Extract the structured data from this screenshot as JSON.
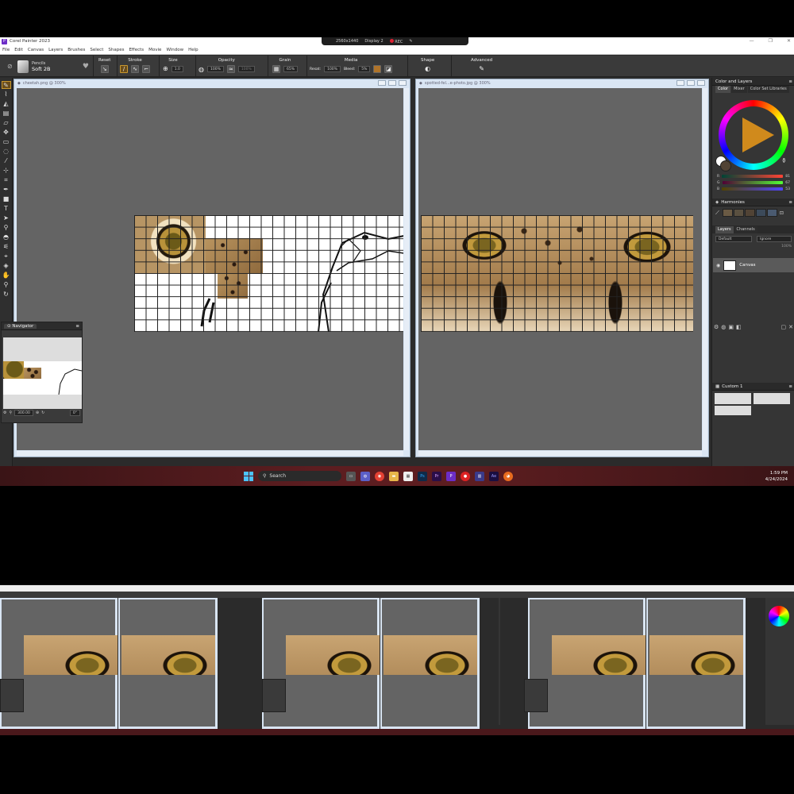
{
  "recording_bar": {
    "resolution": "2560x1440",
    "display": "Display 2",
    "rec_label": "REC"
  },
  "app": {
    "title": "Corel Painter 2023",
    "icon_letter": "P",
    "window_buttons": [
      "—",
      "❐",
      "✕"
    ]
  },
  "menu": [
    "File",
    "Edit",
    "Canvas",
    "Layers",
    "Brushes",
    "Select",
    "Shapes",
    "Effects",
    "Movie",
    "Window",
    "Help"
  ],
  "property_bar": {
    "brush_category": "Pencils",
    "brush_variant": "Soft 2B",
    "groups": {
      "reset": "Reset",
      "stroke": "Stroke",
      "size": "Size",
      "size_value": "1.0",
      "opacity": "Opacity",
      "opacity_value": "100%",
      "opacity_value2": "100%",
      "grain": "Grain",
      "grain_value": "65%",
      "media": "Media",
      "resat_label": "Resat:",
      "resat_value": "100%",
      "bleed_label": "Bleed:",
      "bleed_value": "5%",
      "shape": "Shape",
      "advanced": "Advanced"
    }
  },
  "documents": {
    "left": {
      "title": "cheetah.png @ 300%"
    },
    "right": {
      "title": "spotted-fel...e-photo.jpg @ 300%"
    }
  },
  "navigator": {
    "title": "Navigator",
    "zoom": "300.00",
    "rotation": "0°"
  },
  "right_panel": {
    "color_layers_title": "Color and Layers",
    "color_tabs": [
      "Color",
      "Mixer",
      "Color Set Libraries"
    ],
    "rgb": [
      {
        "label": "R",
        "value": "81"
      },
      {
        "label": "G",
        "value": "67"
      },
      {
        "label": "B",
        "value": "53"
      }
    ],
    "harmonies_title": "Harmonies",
    "layers_tabs": [
      "Layers",
      "Channels"
    ],
    "layer_blend": "Default",
    "layer_ignore": "Ignore",
    "layer_opacity": "100%",
    "layer_name": "Canvas",
    "custom_title": "Custom 1"
  },
  "taskbar": {
    "search_label": "Search",
    "apps": [
      "Ps",
      "Pr",
      "P",
      "Ae"
    ],
    "time": "1:59 PM",
    "date": "4/24/2024"
  },
  "colors": {
    "accent": "#c9982e",
    "panel_bg": "#353535",
    "canvas_gray": "#646464",
    "taskbar": "#5c1d20",
    "current_color": "#514335"
  }
}
